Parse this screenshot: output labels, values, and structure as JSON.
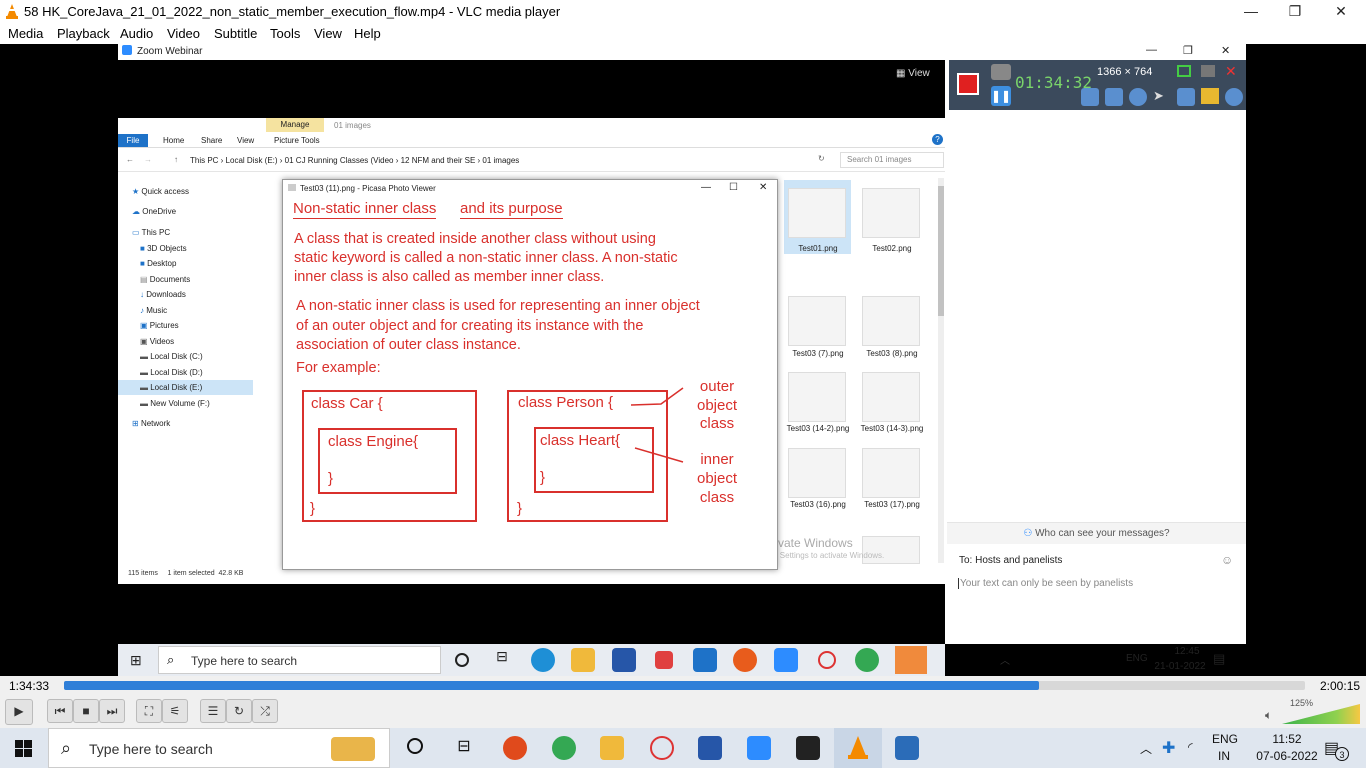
{
  "window": {
    "title": "58 HK_CoreJava_21_01_2022_non_static_member_execution_flow.mp4 - VLC media player",
    "minimize": "—",
    "maximize": "❐",
    "close": "✕"
  },
  "menu": [
    "Media",
    "Playback",
    "Audio",
    "Video",
    "Subtitle",
    "Tools",
    "View",
    "Help"
  ],
  "zoom": {
    "title": "Zoom Webinar",
    "view_label": "View",
    "chat": {
      "who_can_see": "Who can see your messages?",
      "to": "To:  Hosts and panelists",
      "placeholder": "Your text can only be seen by panelists"
    }
  },
  "recorder": {
    "time": "01:34:32",
    "resolution": "1366 × 764"
  },
  "explorer": {
    "tabs": [
      "File",
      "Home",
      "Share",
      "View"
    ],
    "manage": "Manage",
    "picture_tools": "Picture Tools",
    "folder": "01 images",
    "address": "This PC  ›  Local Disk (E:)  ›  01 CJ Running Classes (Video  ›  12 NFM and their SE  ›  01 images",
    "search_placeholder": "Search 01 images",
    "nav": [
      "Quick access",
      "OneDrive",
      "This PC",
      "3D Objects",
      "Desktop",
      "Documents",
      "Downloads",
      "Music",
      "Pictures",
      "Videos",
      "Local Disk (C:)",
      "Local Disk (D:)",
      "Local Disk (E:)",
      "New Volume (F:)",
      "Network"
    ],
    "thumbs": [
      "Test01.png",
      "Test02.png",
      "Test03 (7).png",
      "Test03 (8).png",
      "Test03 (14-2).png",
      "Test03 (14-3).png",
      "Test03 (16).png",
      "Test03 (17).png"
    ],
    "status": "115 items     1 item selected  42.8 KB",
    "activate": "Activate Windows",
    "activate_sub": "Go to Settings to activate Windows."
  },
  "picasa": {
    "title": "Test03 (11).png - Picasa Photo Viewer",
    "heading1": "Non-static inner class",
    "heading2": "and its purpose",
    "para1": [
      "A class that is created inside another class without using",
      "static keyword is called a non-static inner class. A non-static",
      "inner class is also called as member inner class."
    ],
    "para2": [
      "A non-static inner class is used for representing an inner object",
      "of an outer object and for creating its instance with the",
      "association of outer class instance."
    ],
    "for_example": "For example:",
    "car": "class Car {",
    "engine": "class Engine{",
    "person": "class Person {",
    "heart": "class Heart{",
    "close_brace": "}",
    "outer_label": [
      "outer",
      "object",
      "class"
    ],
    "inner_label": [
      "inner",
      "object",
      "class"
    ]
  },
  "inner_taskbar": {
    "search": "Type here to search",
    "lang": "ENG",
    "time": "12:45",
    "date": "21-01-2022"
  },
  "player": {
    "elapsed": "1:34:33",
    "total": "2:00:15",
    "progress": 0.7855,
    "volume": "125%"
  },
  "taskbar": {
    "search": "Type here to search",
    "lang1": "ENG",
    "lang2": "IN",
    "time": "11:52",
    "date": "07-06-2022",
    "notif": "3"
  }
}
